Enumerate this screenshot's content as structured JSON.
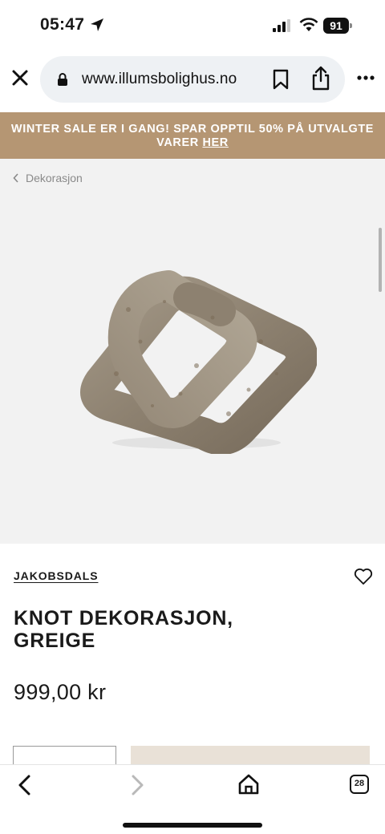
{
  "status_bar": {
    "time": "05:47",
    "battery": "91"
  },
  "browser": {
    "url": "www.illumsbolighus.no"
  },
  "promo": {
    "text": "WINTER SALE ER I GANG! SPAR OPPTIL 50% PÅ UTVALGTE VARER",
    "link": "HER"
  },
  "breadcrumb": {
    "label": "Dekorasjon"
  },
  "product": {
    "brand": "JAKOBSDALS",
    "title": "KNOT DEKORASJON, GREIGE",
    "price": "999,00 kr"
  },
  "toolbar": {
    "tab_count": "28"
  }
}
